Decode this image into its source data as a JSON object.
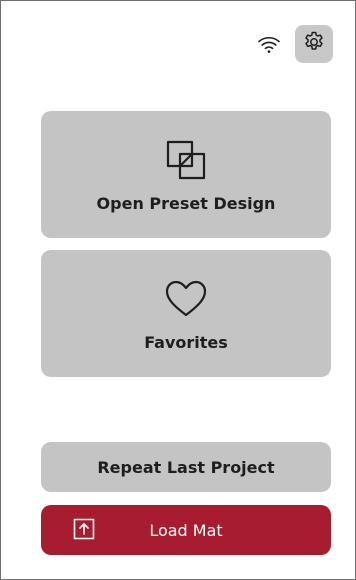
{
  "theme": {
    "card_bg": "#c4c4c4",
    "settings_bg": "#c8c8c8",
    "accent": "#a71d2f",
    "icon_color": "#1e1e1e"
  },
  "status": {
    "wifi_icon": "wifi-icon",
    "settings_icon": "gear-icon"
  },
  "main": {
    "preset": {
      "label": "Open Preset Design",
      "icon": "overlapping-squares-icon"
    },
    "favorites": {
      "label": "Favorites",
      "icon": "heart-icon"
    }
  },
  "actions": {
    "repeat_label": "Repeat Last Project",
    "load_label": "Load Mat",
    "load_icon": "upload-arrow-icon"
  }
}
